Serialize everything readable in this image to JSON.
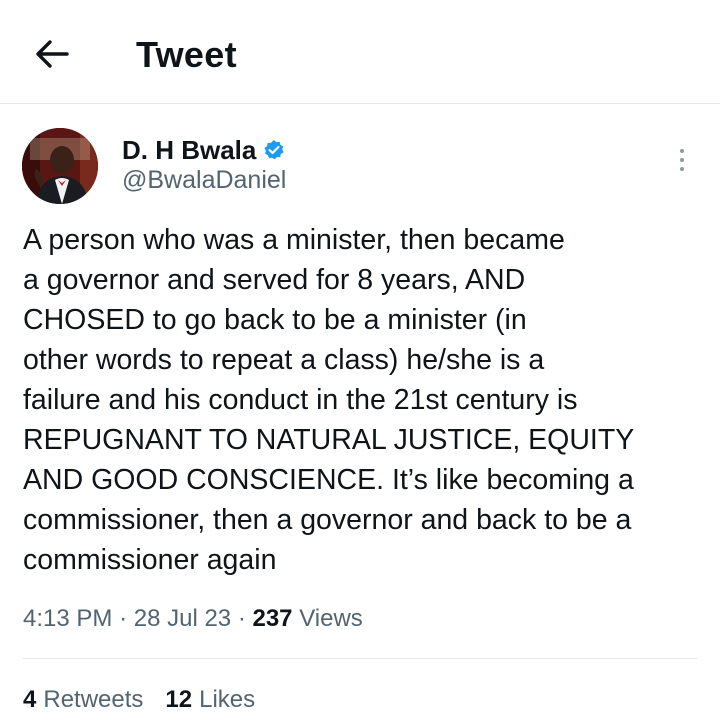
{
  "header": {
    "title": "Tweet",
    "back_icon": "arrow-left-icon"
  },
  "author": {
    "display_name": "D. H Bwala",
    "handle": "@BwalaDaniel",
    "verified_icon": "verified-badge-icon",
    "verified_color": "#1d9bf0"
  },
  "tweet": {
    "lines": [
      "A person who was a minister, then became",
      "a governor and served for 8 years, AND",
      "CHOSED to go back to be a minister (in",
      "other words to repeat a class) he/she is a",
      "failure and  his conduct in the 21st century is",
      "REPUGNANT TO  NATURAL JUSTICE, EQUITY",
      "AND GOOD CONSCIENCE. It’s like becoming a",
      "commissioner, then a governor and back to be a",
      "commissioner again"
    ],
    "time": "4:13 PM",
    "separator": "·",
    "date": "28 Jul 23",
    "views_count": "237",
    "views_label": "Views"
  },
  "stats": {
    "retweets_count": "4",
    "retweets_label": "Retweets",
    "likes_count": "12",
    "likes_label": "Likes"
  },
  "colors": {
    "text": "#0f1419",
    "secondary": "#536471",
    "divider": "#e6e9ec"
  }
}
